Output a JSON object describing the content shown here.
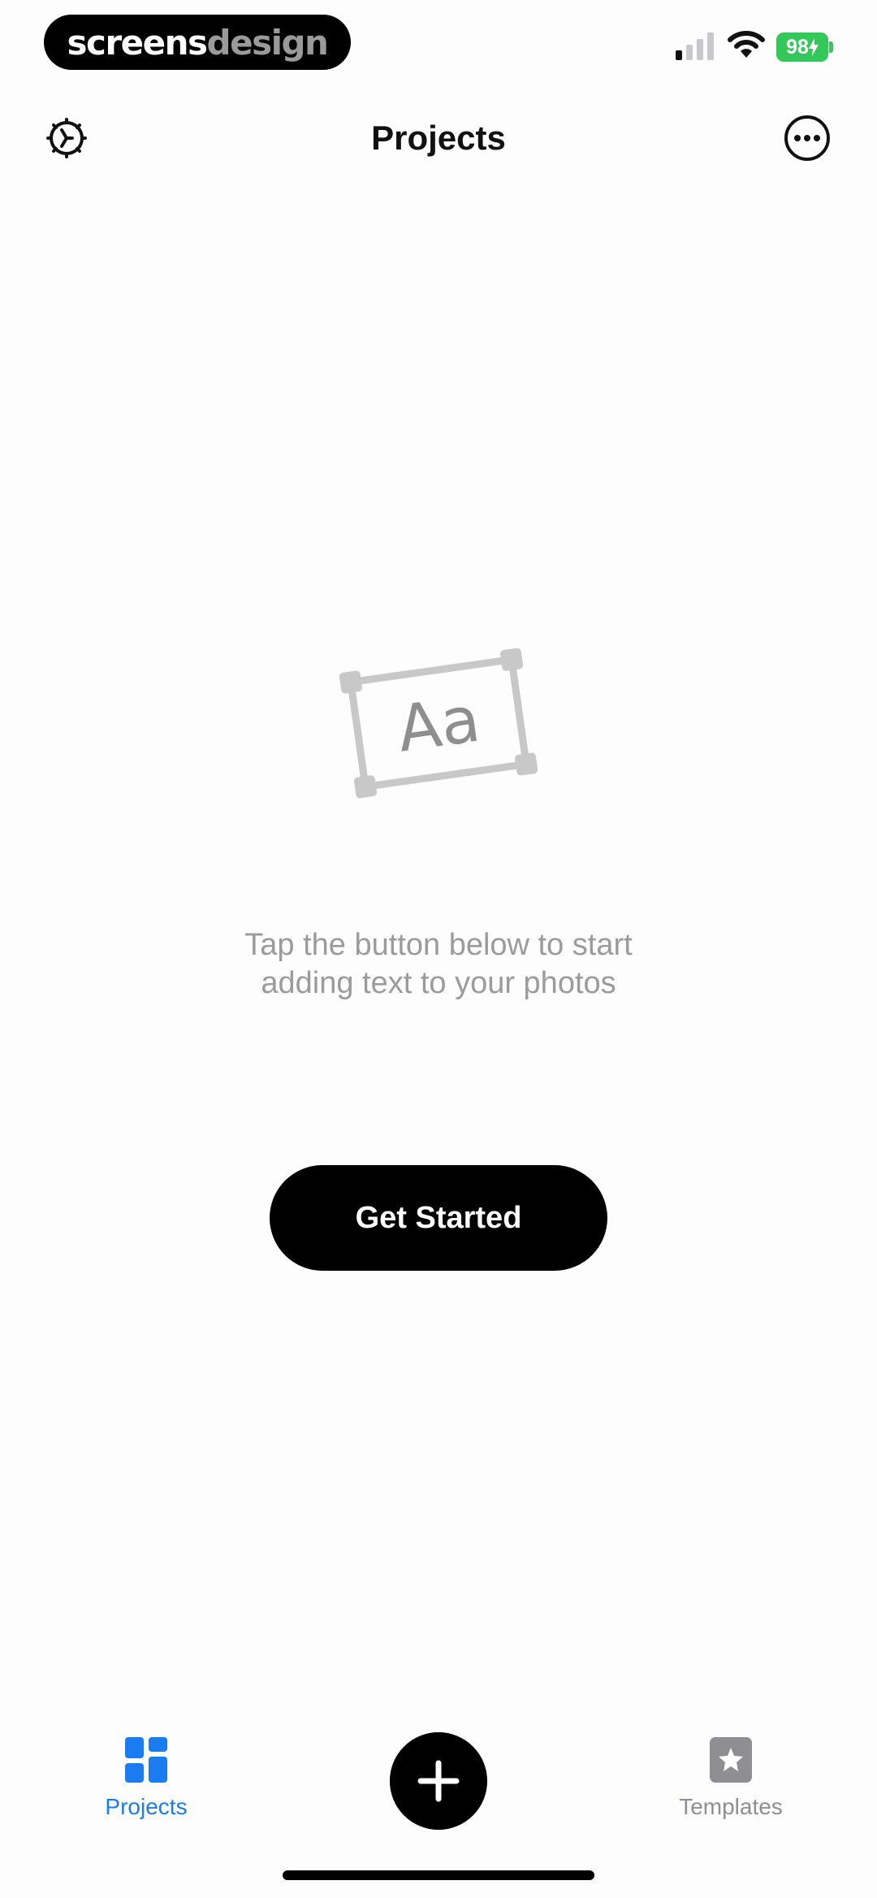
{
  "status_bar": {
    "brand_left": "screens",
    "brand_right": "design",
    "battery": "98",
    "battery_color": "#34c759"
  },
  "nav": {
    "title": "Projects",
    "left_icon": "gear-icon",
    "right_icon": "more-icon"
  },
  "empty_state": {
    "illustration_text": "Aa",
    "message": "Tap the button below to start adding text to your photos",
    "button_label": "Get Started"
  },
  "tab_bar": {
    "tabs": [
      {
        "label": "Projects",
        "icon": "grid-icon",
        "active": true
      },
      {
        "label": "Templates",
        "icon": "star-icon",
        "active": false
      }
    ],
    "center_button_icon": "plus-icon",
    "active_color": "#1a7cf0",
    "inactive_color": "#8e8e93"
  }
}
